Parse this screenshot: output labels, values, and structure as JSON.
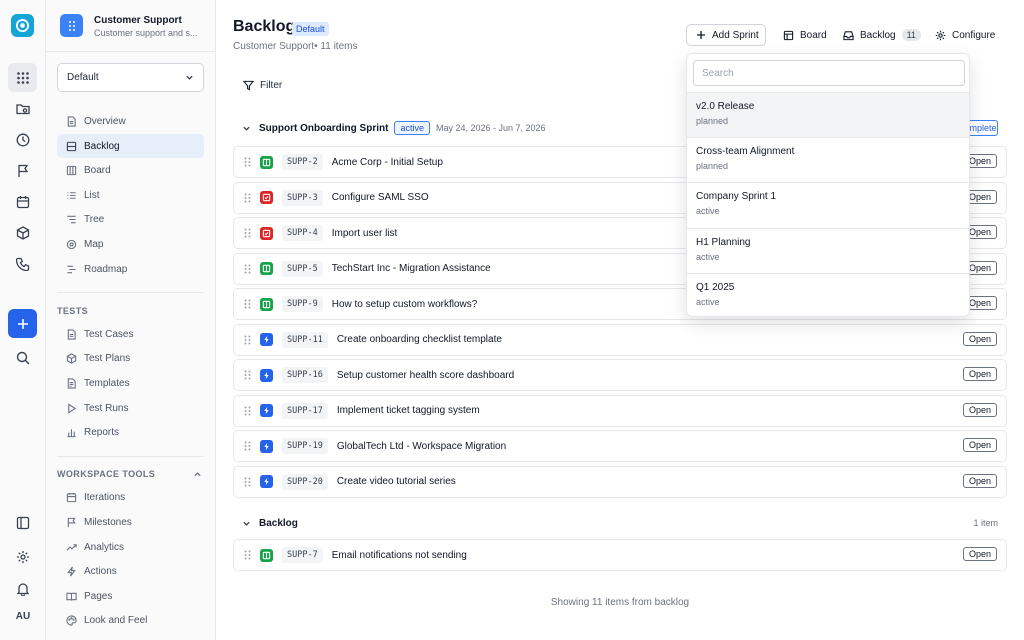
{
  "rail": {
    "user_initials": "AU"
  },
  "project": {
    "name": "Customer Support",
    "description": "Customer support and s..."
  },
  "view_select": {
    "value": "Default"
  },
  "nav": [
    {
      "label": "Overview",
      "icon": "overview-icon",
      "active": false
    },
    {
      "label": "Backlog",
      "icon": "backlog-icon",
      "active": true
    },
    {
      "label": "Board",
      "icon": "board-icon",
      "active": false
    },
    {
      "label": "List",
      "icon": "list-icon",
      "active": false
    },
    {
      "label": "Tree",
      "icon": "tree-icon",
      "active": false
    },
    {
      "label": "Map",
      "icon": "map-icon",
      "active": false
    },
    {
      "label": "Roadmap",
      "icon": "roadmap-icon",
      "active": false
    }
  ],
  "tests": {
    "title": "TESTS",
    "items": [
      {
        "label": "Test Cases",
        "icon": "file-icon"
      },
      {
        "label": "Test Plans",
        "icon": "box-icon"
      },
      {
        "label": "Templates",
        "icon": "template-icon"
      },
      {
        "label": "Test Runs",
        "icon": "play-icon"
      },
      {
        "label": "Reports",
        "icon": "chart-icon"
      }
    ]
  },
  "workspace_tools": {
    "title": "WORKSPACE TOOLS",
    "items": [
      {
        "label": "Iterations",
        "icon": "calendar-icon"
      },
      {
        "label": "Milestones",
        "icon": "flag-icon"
      },
      {
        "label": "Analytics",
        "icon": "trend-icon"
      },
      {
        "label": "Actions",
        "icon": "bolt-icon"
      },
      {
        "label": "Pages",
        "icon": "book-icon"
      },
      {
        "label": "Look and Feel",
        "icon": "palette-icon"
      }
    ]
  },
  "header": {
    "title": "Backlog",
    "badge": "Default",
    "subtitle": "Customer Support• 11 items",
    "add_sprint": "Add Sprint",
    "board": "Board",
    "backlog": "Backlog",
    "backlog_count": "11",
    "configure": "Configure"
  },
  "filter_label": "Filter",
  "sprint": {
    "name": "Support Onboarding Sprint",
    "status": "active",
    "dates": "May 24, 2026 - Jun 7, 2026",
    "complete_label": "Complete"
  },
  "sprint_items": [
    {
      "key": "SUPP-2",
      "title": "Acme Corp - Initial Setup",
      "type": "story",
      "status": "Open"
    },
    {
      "key": "SUPP-3",
      "title": "Configure SAML SSO",
      "type": "bug",
      "status": "Open"
    },
    {
      "key": "SUPP-4",
      "title": "Import user list",
      "type": "bug",
      "status": "Open"
    },
    {
      "key": "SUPP-5",
      "title": "TechStart Inc - Migration Assistance",
      "type": "story",
      "status": "Open"
    },
    {
      "key": "SUPP-9",
      "title": "How to setup custom workflows?",
      "type": "story",
      "status": "Open"
    },
    {
      "key": "SUPP-11",
      "title": "Create onboarding checklist template",
      "type": "task",
      "status": "Open"
    },
    {
      "key": "SUPP-16",
      "title": "Setup customer health score dashboard",
      "type": "task",
      "status": "Open"
    },
    {
      "key": "SUPP-17",
      "title": "Implement ticket tagging system",
      "type": "task",
      "status": "Open"
    },
    {
      "key": "SUPP-19",
      "title": "GlobalTech Ltd - Workspace Migration",
      "type": "task",
      "status": "Open"
    },
    {
      "key": "SUPP-20",
      "title": "Create video tutorial series",
      "type": "task",
      "status": "Open"
    }
  ],
  "backlog_group": {
    "name": "Backlog",
    "count": "1 item"
  },
  "backlog_items": [
    {
      "key": "SUPP-7",
      "title": "Email notifications not sending",
      "type": "story",
      "status": "Open"
    }
  ],
  "footer": "Showing 11 items from backlog",
  "dropdown": {
    "placeholder": "Search",
    "options": [
      {
        "name": "v2.0 Release",
        "state": "planned"
      },
      {
        "name": "Cross-team Alignment",
        "state": "planned"
      },
      {
        "name": "Company Sprint 1",
        "state": "active"
      },
      {
        "name": "H1 Planning",
        "state": "active"
      },
      {
        "name": "Q1 2025",
        "state": "active"
      }
    ]
  }
}
